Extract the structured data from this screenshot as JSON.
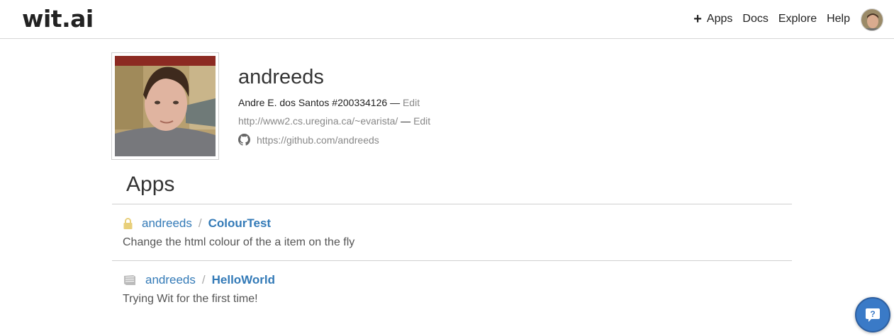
{
  "header": {
    "logo": "wit.ai",
    "nav": {
      "plus": "+",
      "apps": "Apps",
      "docs": "Docs",
      "explore": "Explore",
      "help": "Help"
    }
  },
  "profile": {
    "username": "andreeds",
    "realname": "Andre E. dos Santos #200334126",
    "dash": "—",
    "edit_label": "Edit",
    "website": "http://www2.cs.uregina.ca/~evarista/",
    "github": "https://github.com/andreeds"
  },
  "apps_section": {
    "title": "Apps",
    "separator": "/",
    "items": [
      {
        "icon": "lock-icon",
        "owner": "andreeds",
        "name": "ColourTest",
        "description": "Change the html colour of the a item on the fly"
      },
      {
        "icon": "book-icon",
        "owner": "andreeds",
        "name": "HelloWorld",
        "description": "Trying Wit for the first time!"
      }
    ]
  },
  "colors": {
    "link": "#337ab7",
    "lock": "#e8cf7a",
    "help_bubble": "#3a7ac7"
  }
}
